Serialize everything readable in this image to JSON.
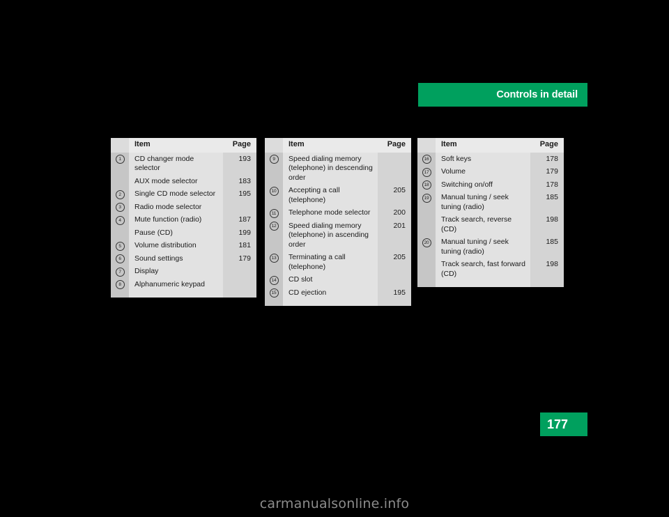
{
  "header": {
    "banner_title": "Controls in detail",
    "banner_color": "#00a05e"
  },
  "page_tab": {
    "page_number": "177",
    "color": "#00a05e"
  },
  "watermark": {
    "text": "carmanualsonline.info"
  },
  "tables": [
    {
      "id": "table-1",
      "columns": {
        "item": "Item",
        "page": "Page"
      },
      "rows": [
        {
          "num": "1",
          "item": "CD changer mode selector",
          "page": "193"
        },
        {
          "num": "",
          "item": "AUX mode selector",
          "page": "183"
        },
        {
          "num": "2",
          "item": "Single CD mode selector",
          "page": "195"
        },
        {
          "num": "3",
          "item": "Radio mode selector",
          "page": ""
        },
        {
          "num": "4",
          "item": "Mute function (radio)",
          "page": "187"
        },
        {
          "num": "",
          "item": "Pause (CD)",
          "page": "199"
        },
        {
          "num": "5",
          "item": "Volume distribution",
          "page": "181"
        },
        {
          "num": "6",
          "item": "Sound settings",
          "page": "179"
        },
        {
          "num": "7",
          "item": "Display",
          "page": ""
        },
        {
          "num": "8",
          "item": "Alphanumeric keypad",
          "page": ""
        }
      ]
    },
    {
      "id": "table-2",
      "columns": {
        "item": "Item",
        "page": "Page"
      },
      "rows": [
        {
          "num": "9",
          "item": "Speed dialing memory (telephone) in descending order",
          "page": ""
        },
        {
          "num": "10",
          "item": "Accepting a call (telephone)",
          "page": "205"
        },
        {
          "num": "11",
          "item": "Telephone mode selector",
          "page": "200"
        },
        {
          "num": "12",
          "item": "Speed dialing memory (telephone) in ascending order",
          "page": "201"
        },
        {
          "num": "13",
          "item": "Terminating a call (telephone)",
          "page": "205"
        },
        {
          "num": "14",
          "item": "CD slot",
          "page": ""
        },
        {
          "num": "15",
          "item": "CD ejection",
          "page": "195"
        }
      ]
    },
    {
      "id": "table-3",
      "columns": {
        "item": "Item",
        "page": "Page"
      },
      "rows": [
        {
          "num": "16",
          "item": "Soft keys",
          "page": "178"
        },
        {
          "num": "17",
          "item": "Volume",
          "page": "179"
        },
        {
          "num": "18",
          "item": "Switching on/off",
          "page": "178"
        },
        {
          "num": "19",
          "item": "Manual tuning / seek tuning (radio)",
          "page": "185"
        },
        {
          "num": "",
          "item": "Track search, reverse (CD)",
          "page": "198"
        },
        {
          "num": "20",
          "item": "Manual tuning / seek tuning (radio)",
          "page": "185"
        },
        {
          "num": "",
          "item": "Track search, fast forward (CD)",
          "page": "198"
        }
      ]
    }
  ]
}
